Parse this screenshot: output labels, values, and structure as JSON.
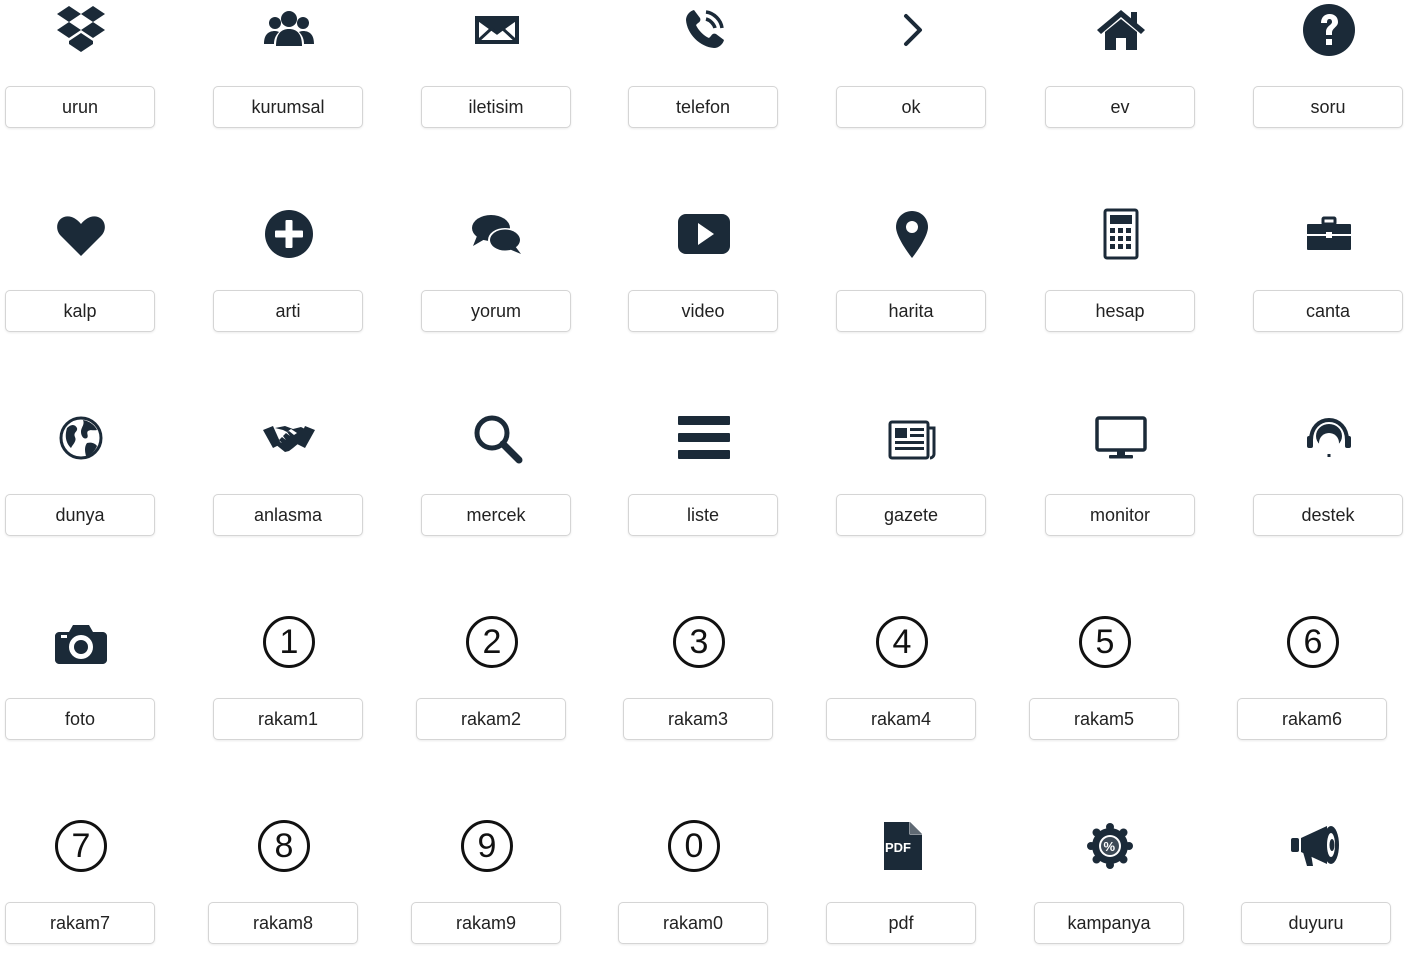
{
  "icons": [
    {
      "label": "urun",
      "icon": "dropbox-icon"
    },
    {
      "label": "kurumsal",
      "icon": "users-icon"
    },
    {
      "label": "iletisim",
      "icon": "envelope-icon"
    },
    {
      "label": "telefon",
      "icon": "phone-icon"
    },
    {
      "label": "ok",
      "icon": "chevron-right-icon"
    },
    {
      "label": "ev",
      "icon": "home-icon"
    },
    {
      "label": "soru",
      "icon": "question-circle-icon"
    },
    {
      "label": "kalp",
      "icon": "heart-icon"
    },
    {
      "label": "arti",
      "icon": "plus-circle-icon"
    },
    {
      "label": "yorum",
      "icon": "comments-icon"
    },
    {
      "label": "video",
      "icon": "play-video-icon"
    },
    {
      "label": "harita",
      "icon": "map-marker-icon"
    },
    {
      "label": "hesap",
      "icon": "calculator-icon"
    },
    {
      "label": "canta",
      "icon": "briefcase-icon"
    },
    {
      "label": "dunya",
      "icon": "globe-icon"
    },
    {
      "label": "anlasma",
      "icon": "handshake-icon"
    },
    {
      "label": "mercek",
      "icon": "search-icon"
    },
    {
      "label": "liste",
      "icon": "bars-icon"
    },
    {
      "label": "gazete",
      "icon": "newspaper-icon"
    },
    {
      "label": "monitor",
      "icon": "monitor-icon"
    },
    {
      "label": "destek",
      "icon": "support-headset-icon"
    },
    {
      "label": "foto",
      "icon": "camera-icon"
    },
    {
      "label": "rakam1",
      "icon": "number-1-icon",
      "digit": "1"
    },
    {
      "label": "rakam2",
      "icon": "number-2-icon",
      "digit": "2"
    },
    {
      "label": "rakam3",
      "icon": "number-3-icon",
      "digit": "3"
    },
    {
      "label": "rakam4",
      "icon": "number-4-icon",
      "digit": "4"
    },
    {
      "label": "rakam5",
      "icon": "number-5-icon",
      "digit": "5"
    },
    {
      "label": "rakam6",
      "icon": "number-6-icon",
      "digit": "6"
    },
    {
      "label": "rakam7",
      "icon": "number-7-icon",
      "digit": "7"
    },
    {
      "label": "rakam8",
      "icon": "number-8-icon",
      "digit": "8"
    },
    {
      "label": "rakam9",
      "icon": "number-9-icon",
      "digit": "9"
    },
    {
      "label": "rakam0",
      "icon": "number-0-icon",
      "digit": "0"
    },
    {
      "label": "pdf",
      "icon": "pdf-file-icon",
      "glyph_text": "PDF"
    },
    {
      "label": "kampanya",
      "icon": "discount-badge-icon",
      "glyph_text": "%"
    },
    {
      "label": "duyuru",
      "icon": "megaphone-icon"
    }
  ],
  "colors": {
    "icon": "#1b2a38",
    "label_text": "#222222",
    "label_border": "#d5d5d5",
    "background": "#ffffff"
  }
}
